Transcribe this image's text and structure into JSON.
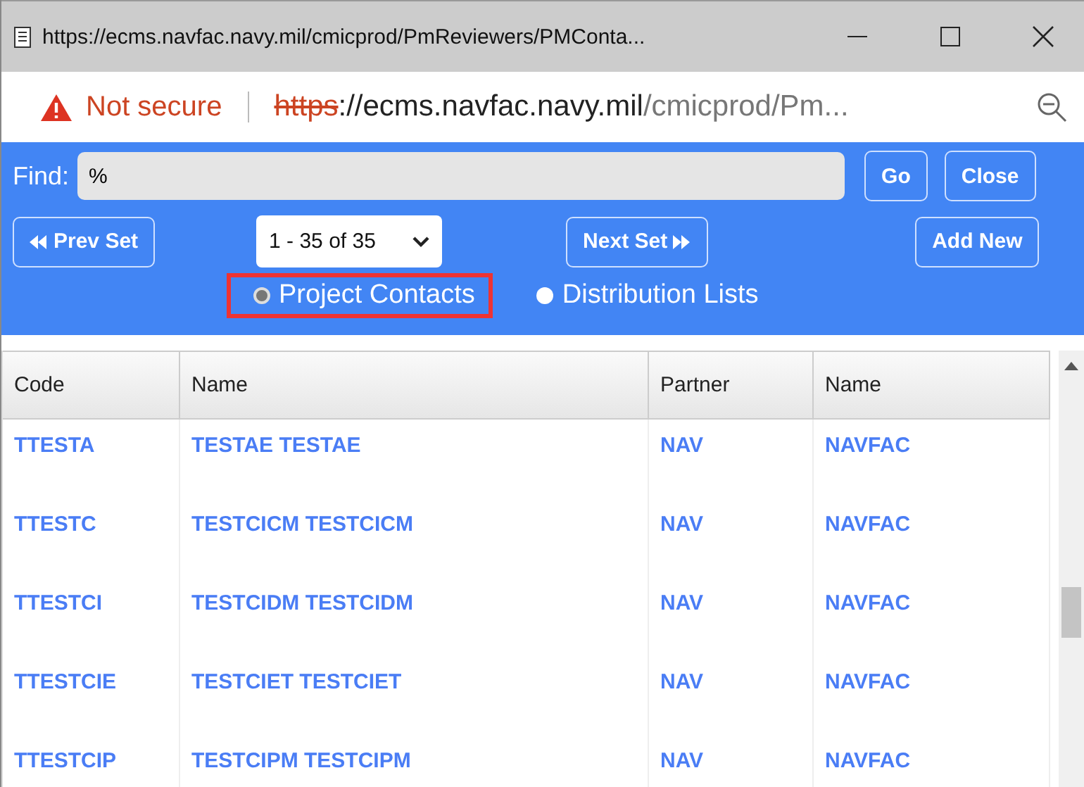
{
  "window": {
    "title": "https://ecms.navfac.navy.mil/cmicprod/PmReviewers/PMConta..."
  },
  "address_bar": {
    "security": "Not secure",
    "scheme": "https",
    "rest_host": "://ecms.navfac.navy.mil",
    "rest_path": "/cmicprod/Pm..."
  },
  "find": {
    "label": "Find:",
    "value": "%"
  },
  "buttons": {
    "go": "Go",
    "close": "Close",
    "prev": "Prev Set",
    "next": "Next Set",
    "add": "Add New"
  },
  "page_select": {
    "value": "1  - 35 of 35"
  },
  "radios": [
    {
      "label": "Project Contacts",
      "selected": true
    },
    {
      "label": "Distribution Lists",
      "selected": false
    }
  ],
  "table": {
    "columns": [
      "Code",
      "Name",
      "Partner",
      "Name"
    ],
    "rows": [
      [
        "TTESTA",
        "TESTAE TESTAE",
        "NAV",
        "NAVFAC"
      ],
      [
        "TTESTC",
        "TESTCICM TESTCICM",
        "NAV",
        "NAVFAC"
      ],
      [
        "TTESTCI",
        "TESTCIDM TESTCIDM",
        "NAV",
        "NAVFAC"
      ],
      [
        "TTESTCIE",
        "TESTCIET TESTCIET",
        "NAV",
        "NAVFAC"
      ],
      [
        "TTESTCIP",
        "TESTCIPM TESTCIPM",
        "NAV",
        "NAVFAC"
      ]
    ]
  }
}
